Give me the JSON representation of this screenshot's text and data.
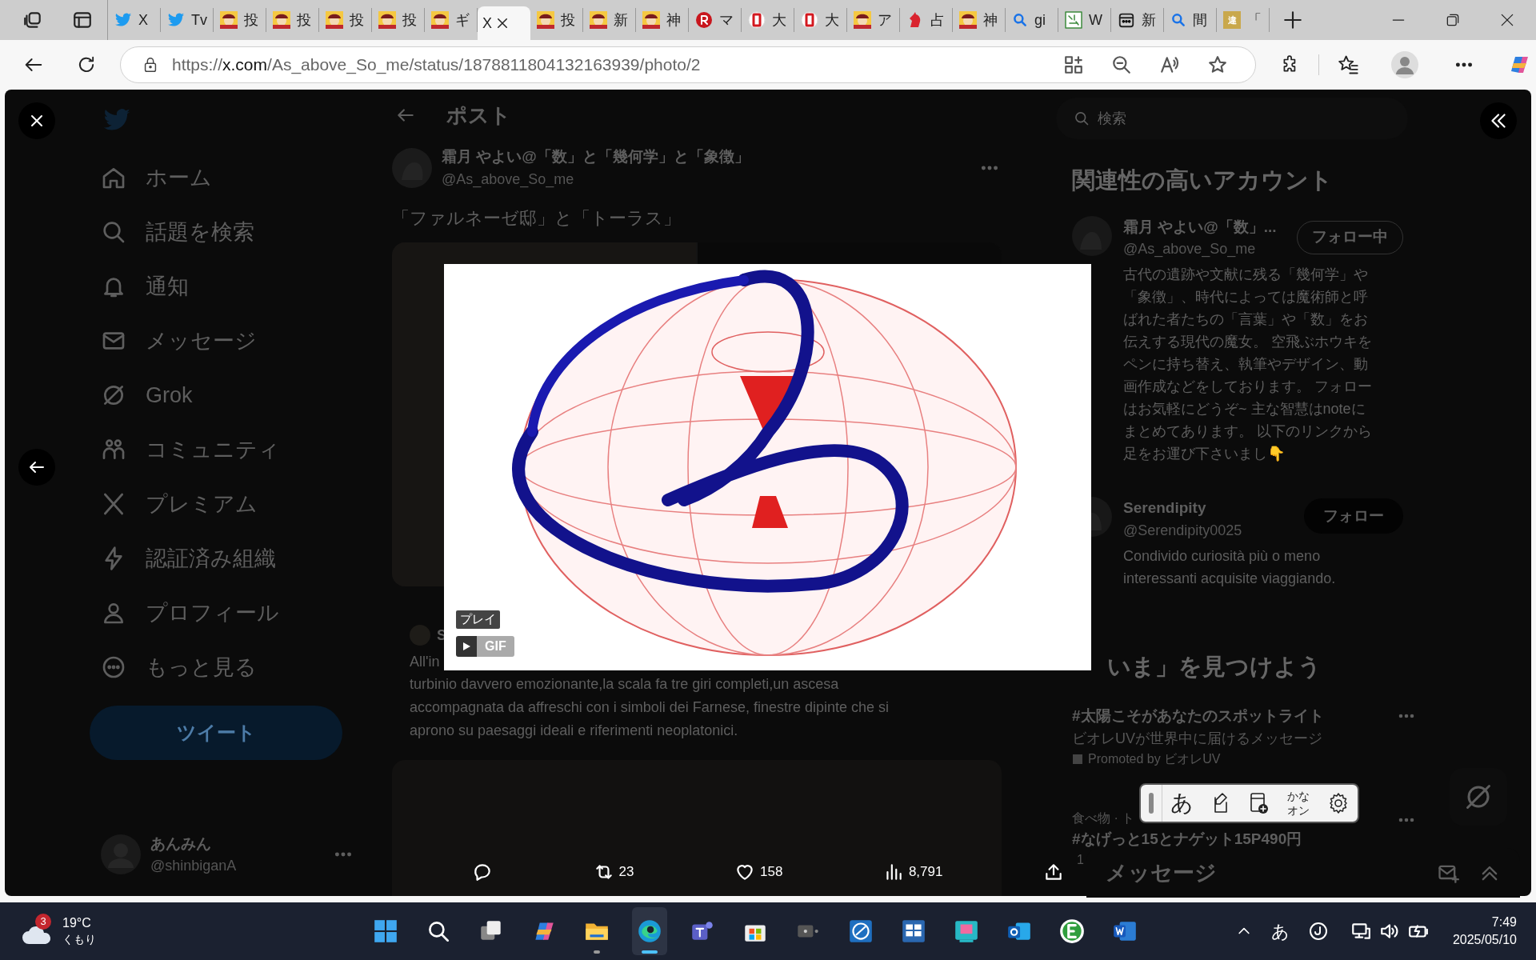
{
  "browser": {
    "tabs": [
      {
        "kind": "twitter",
        "label": "X",
        "selected": false
      },
      {
        "kind": "twitter",
        "label": "Tv",
        "selected": false
      },
      {
        "kind": "avatar",
        "label": "投",
        "selected": false
      },
      {
        "kind": "avatar",
        "label": "投",
        "selected": false
      },
      {
        "kind": "avatar",
        "label": "投",
        "selected": false
      },
      {
        "kind": "avatar",
        "label": "投",
        "selected": false
      },
      {
        "kind": "avatar",
        "label": "ギ",
        "selected": false
      },
      {
        "kind": "none",
        "label": "X",
        "selected": true
      },
      {
        "kind": "avatar",
        "label": "投",
        "selected": false
      },
      {
        "kind": "avatar",
        "label": "新",
        "selected": false
      },
      {
        "kind": "avatar",
        "label": "神",
        "selected": false
      },
      {
        "kind": "red-circle",
        "label": "マ",
        "selected": false
      },
      {
        "kind": "red-d",
        "label": "大",
        "selected": false
      },
      {
        "kind": "red-d",
        "label": "大",
        "selected": false
      },
      {
        "kind": "avatar",
        "label": "ア",
        "selected": false
      },
      {
        "kind": "unicorn",
        "label": "占",
        "selected": false
      },
      {
        "kind": "avatar",
        "label": "神",
        "selected": false
      },
      {
        "kind": "search",
        "label": "gi",
        "selected": false
      },
      {
        "kind": "green",
        "label": "W",
        "selected": false
      },
      {
        "kind": "calendar",
        "label": "新",
        "selected": false
      },
      {
        "kind": "search",
        "label": "間",
        "selected": false
      },
      {
        "kind": "gold",
        "icon_text": "違",
        "label": "「",
        "selected": false
      }
    ],
    "address": {
      "scheme": "https://",
      "host": "x.com",
      "path": "/As_above_So_me/status/1878811804132163939/photo/2"
    }
  },
  "nav": {
    "items": [
      {
        "kind": "home",
        "label": "ホーム"
      },
      {
        "kind": "search",
        "label": "話題を検索"
      },
      {
        "kind": "bell",
        "label": "通知"
      },
      {
        "kind": "mail",
        "label": "メッセージ"
      },
      {
        "kind": "grok",
        "label": "Grok"
      },
      {
        "kind": "people",
        "label": "コミュニティ"
      },
      {
        "kind": "x",
        "label": "プレミアム"
      },
      {
        "kind": "bolt",
        "label": "認証済み組織"
      },
      {
        "kind": "person",
        "label": "プロフィール"
      },
      {
        "kind": "more",
        "label": "もっと見る"
      }
    ],
    "tweet_button": "ツイート",
    "user": {
      "name": "あんみん",
      "handle": "@shinbiganA"
    }
  },
  "post": {
    "header": "ポスト",
    "author": {
      "name": "霜月 やよい@「数」と「幾何学」と「象徴」",
      "handle": "@As_above_So_me"
    },
    "text": "「ファルネーゼ邸」と「トーラス」",
    "quote": {
      "author": "S",
      "start": "All'in",
      "text": "turbinio davvero emozionante,la scala fa tre giri completi,un ascesa accompagnata da affreschi con i simboli dei Farnese, finestre dipinte che si aprono su paesaggi ideali e riferimenti neoplatonici."
    }
  },
  "sidebar": {
    "search_placeholder": "検索",
    "accounts_title": "関連性の高いアカウント",
    "accounts": [
      {
        "name": "霜月 やよい@「数」...",
        "handle": "@As_above_So_me",
        "following": true,
        "button": "フォロー中",
        "bio": "古代の遺跡や文献に残る「幾何学」や「象徴」、時代によっては魔術師と呼ばれた者たちの「言葉」や「数」をお伝えする現代の魔女。 空飛ぶホウキをペンに持ち替え、執筆やデザイン、動画作成などをしております。 フォローはお気軽にどうぞ~ 主な智慧はnoteにまとめてあります。 以下のリンクから足をお運び下さいまし👇"
      },
      {
        "name": "Serendipity",
        "handle": "@Serendipity0025",
        "following": false,
        "button": "フォロー",
        "bio": "Condivido curiosità più o meno interessanti acquisite viaggiando."
      }
    ],
    "trends_title": "いま」を見つけよう",
    "trends": [
      {
        "kind": "promoted",
        "title": "#太陽こそがあなたのスポットライト",
        "subtitle": "ビオレUVが世界中に届けるメッセージ",
        "promoted": "Promoted by ビオレUV"
      },
      {
        "kind": "topic",
        "context": "食べ物 · ト",
        "title": "#なげっと15とナゲット15P490円",
        "count": "1"
      }
    ],
    "messages": "メッセージ"
  },
  "viewer": {
    "gif_label": "プレイ",
    "gif_badge": "GIF",
    "stats": [
      {
        "kind": "reply"
      },
      {
        "kind": "retweet",
        "count": "23"
      },
      {
        "kind": "like",
        "count": "158"
      },
      {
        "kind": "views",
        "count": "8,791"
      },
      {
        "kind": "share"
      }
    ]
  },
  "ime": {
    "items": [
      {
        "kind": "handle"
      },
      {
        "kind": "text",
        "label": "あ"
      },
      {
        "kind": "pen"
      },
      {
        "kind": "doc-add"
      },
      {
        "kind": "toggle",
        "label": "かな",
        "label2": "オン"
      },
      {
        "kind": "gear"
      }
    ]
  },
  "taskbar": {
    "weather": {
      "badge": "3",
      "temp": "19°C",
      "condition": "くもり"
    },
    "apps": [
      {
        "kind": "start",
        "running": false,
        "selected": false
      },
      {
        "kind": "search",
        "running": false,
        "selected": false
      },
      {
        "kind": "taskview",
        "running": false,
        "selected": false
      },
      {
        "kind": "copilot",
        "running": false,
        "selected": false
      },
      {
        "kind": "files",
        "running": true,
        "selected": false
      },
      {
        "kind": "edge",
        "running": true,
        "selected": true
      },
      {
        "kind": "teams",
        "running": false,
        "selected": false
      },
      {
        "kind": "store",
        "running": false,
        "selected": false
      },
      {
        "kind": "camera",
        "running": false,
        "selected": false
      },
      {
        "kind": "blue-app",
        "running": false,
        "selected": false
      },
      {
        "kind": "board",
        "running": false,
        "selected": false
      },
      {
        "kind": "teal-app",
        "running": false,
        "selected": false
      },
      {
        "kind": "outlook",
        "running": false,
        "selected": false
      },
      {
        "kind": "evernote",
        "running": false,
        "selected": false
      },
      {
        "kind": "word",
        "running": false,
        "selected": false
      }
    ],
    "ime": "あ",
    "time": "7:49",
    "date": "2025/05/10"
  }
}
